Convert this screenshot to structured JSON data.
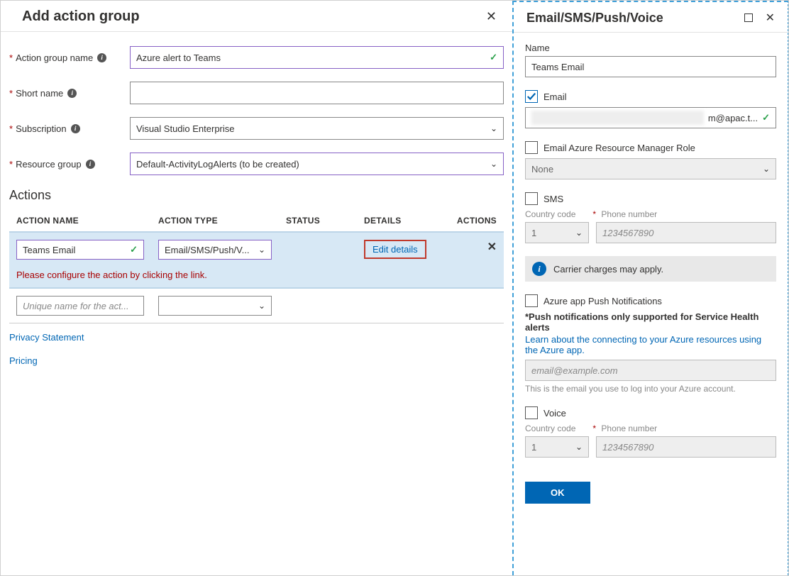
{
  "leftPanel": {
    "title": "Add action group",
    "fields": {
      "actionGroupName": {
        "label": "Action group name",
        "value": "Azure alert to Teams"
      },
      "shortName": {
        "label": "Short name",
        "value": ""
      },
      "subscription": {
        "label": "Subscription",
        "value": "Visual Studio Enterprise"
      },
      "resourceGroup": {
        "label": "Resource group",
        "value": "Default-ActivityLogAlerts (to be created)"
      }
    },
    "actionsHeader": "Actions",
    "table": {
      "columns": {
        "name": "ACTION NAME",
        "type": "ACTION TYPE",
        "status": "STATUS",
        "details": "DETAILS",
        "actions": "ACTIONS"
      },
      "row": {
        "name": "Teams Email",
        "type": "Email/SMS/Push/V...",
        "editDetails": "Edit details",
        "error": "Please configure the action by clicking the link."
      },
      "blankPlaceholder": "Unique name for the act..."
    },
    "links": {
      "privacy": "Privacy Statement",
      "pricing": "Pricing"
    }
  },
  "rightPanel": {
    "title": "Email/SMS/Push/Voice",
    "nameLabel": "Name",
    "nameValue": "Teams Email",
    "email": {
      "label": "Email",
      "checked": true,
      "valueSuffix": "m@apac.t..."
    },
    "armRole": {
      "label": "Email Azure Resource Manager Role",
      "checked": false,
      "selectValue": "None"
    },
    "sms": {
      "label": "SMS",
      "checked": false,
      "countryCodeLabel": "Country code",
      "countryCode": "1",
      "phoneLabel": "Phone number",
      "phonePlaceholder": "1234567890"
    },
    "carrierNote": "Carrier charges may apply.",
    "push": {
      "label": "Azure app Push Notifications",
      "checked": false,
      "note": "*Push notifications only supported for Service Health alerts",
      "learn": "Learn about the connecting to your Azure resources using the Azure app.",
      "placeholder": "email@example.com",
      "hint": "This is the email you use to log into your Azure account."
    },
    "voice": {
      "label": "Voice",
      "checked": false,
      "countryCodeLabel": "Country code",
      "countryCode": "1",
      "phoneLabel": "Phone number",
      "phonePlaceholder": "1234567890"
    },
    "okButton": "OK"
  }
}
